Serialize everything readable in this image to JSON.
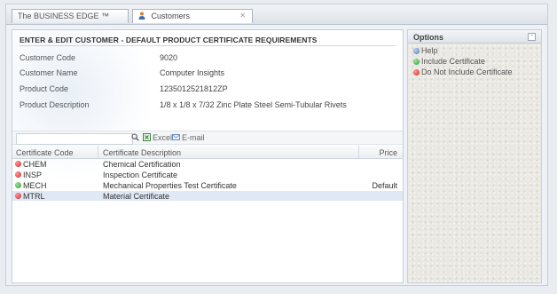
{
  "tabs": [
    {
      "label": "The BUSINESS EDGE ™"
    },
    {
      "label": "Customers"
    }
  ],
  "form": {
    "title": "ENTER & EDIT CUSTOMER - DEFAULT PRODUCT CERTIFICATE REQUIREMENTS",
    "fields": [
      {
        "label": "Customer Code",
        "value": "9020"
      },
      {
        "label": "Customer Name",
        "value": "Computer Insights"
      },
      {
        "label": "Product Code",
        "value": "1235012521812ZP"
      },
      {
        "label": "Product Description",
        "value": "1/8 x 1/8 x 7/32 Zinc Plate Steel Semi-Tubular Rivets"
      }
    ]
  },
  "toolbar": {
    "search_placeholder": "",
    "excel_label": "Excel",
    "email_label": "E-mail"
  },
  "grid": {
    "columns": [
      "Certificate Code",
      "Certificate Description",
      "Price"
    ],
    "rows": [
      {
        "code": "CHEM",
        "description": "Chemical Certification",
        "price": "",
        "status": "red"
      },
      {
        "code": "INSP",
        "description": "Inspection Certificate",
        "price": "",
        "status": "red"
      },
      {
        "code": "MECH",
        "description": "Mechanical Properties Test Certificate",
        "price": "Default",
        "status": "green"
      },
      {
        "code": "MTRL",
        "description": "Material Certificate",
        "price": "",
        "status": "red"
      }
    ]
  },
  "options": {
    "title": "Options",
    "items": [
      {
        "label": "Help",
        "icon": "help-icon"
      },
      {
        "label": "Include Certificate",
        "icon": "include-icon"
      },
      {
        "label": "Do Not Include Certificate",
        "icon": "exclude-icon"
      }
    ]
  },
  "colors": {
    "selected_row": "#dfe8f4",
    "include": "#2a9a2a",
    "exclude": "#d42020"
  }
}
